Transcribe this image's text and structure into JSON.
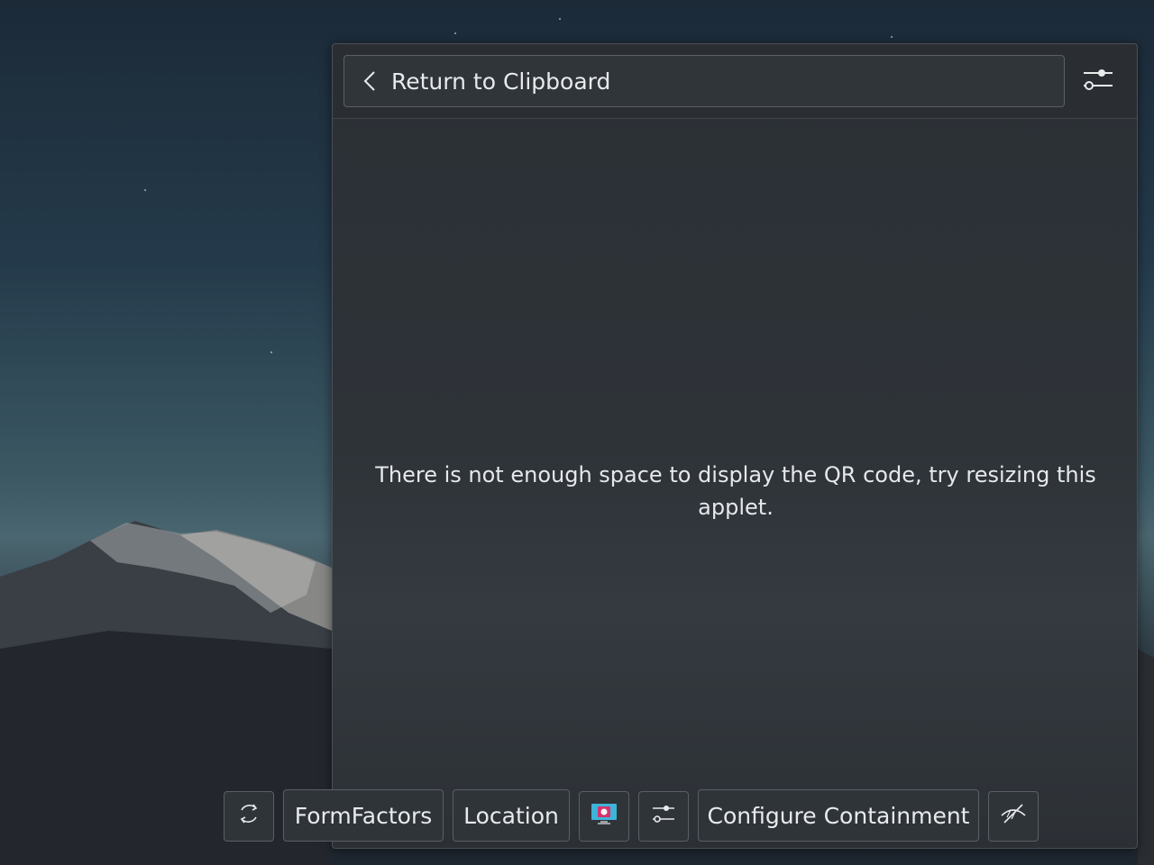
{
  "applet": {
    "back_label": "Return to Clipboard",
    "message": "There is not enough space to display the QR code, try resizing this applet."
  },
  "toolbar": {
    "formfactors_label": "FormFactors",
    "location_label": "Location",
    "configure_containment_label": "Configure Containment",
    "icons": [
      "refresh-icon",
      "screenshot-monitor-icon",
      "sliders-icon",
      "hidden-eye-icon"
    ]
  },
  "colors": {
    "panel_bg": "#2e3338",
    "border": "#5a5f66",
    "text": "#e8eaec"
  }
}
